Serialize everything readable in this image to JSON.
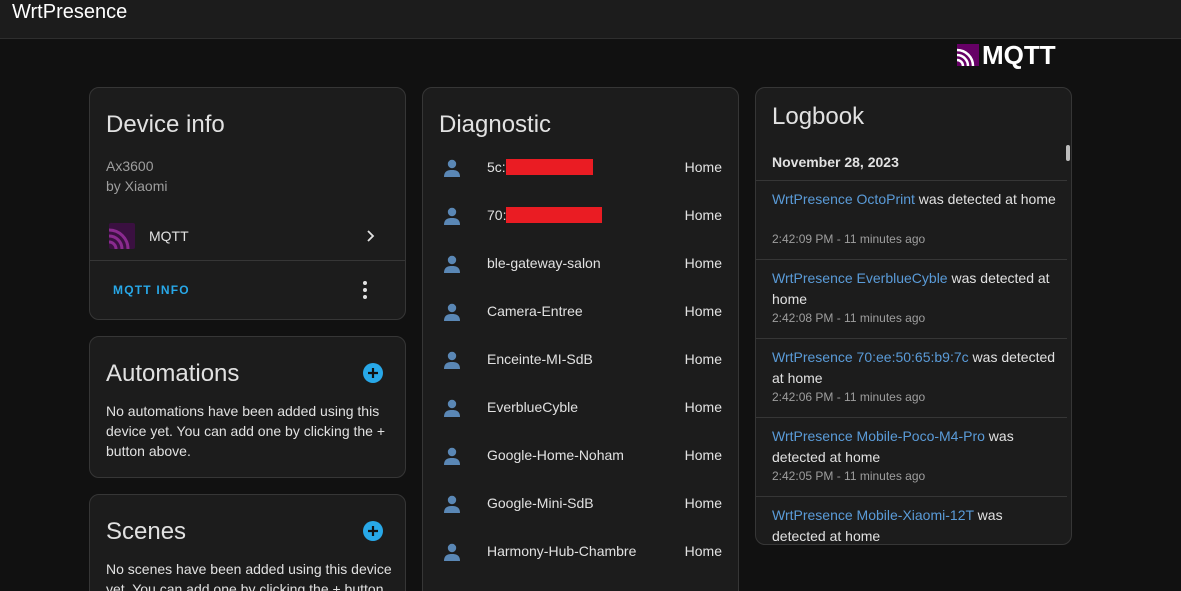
{
  "app": {
    "title": "WrtPresence"
  },
  "integration_logo": {
    "text": "MQTT"
  },
  "colors": {
    "accent": "#28a8e8",
    "link": "#5a9bd8",
    "person_icon": "#5a87b5",
    "redaction": "#ea1c23",
    "mqtt_logo": "#660066"
  },
  "device_info": {
    "title": "Device info",
    "model": "Ax3600",
    "manufacturer": "by Xiaomi",
    "integration_label": "MQTT",
    "action_button": "MQTT INFO"
  },
  "automations": {
    "title": "Automations",
    "empty_text": "No automations have been added using this device yet. You can add one by clicking the + button above."
  },
  "scenes": {
    "title": "Scenes",
    "empty_text": "No scenes have been added using this device yet. You can add one by clicking the + button above."
  },
  "diagnostic": {
    "title": "Diagnostic",
    "entities": [
      {
        "icon": "person-icon",
        "name": "5c:",
        "redacted": true,
        "state": "Home"
      },
      {
        "icon": "person-icon",
        "name": "70:",
        "redacted": true,
        "state": "Home"
      },
      {
        "icon": "person-icon",
        "name": "ble-gateway-salon",
        "redacted": false,
        "state": "Home"
      },
      {
        "icon": "person-icon",
        "name": "Camera-Entree",
        "redacted": false,
        "state": "Home"
      },
      {
        "icon": "person-icon",
        "name": "Enceinte-MI-SdB",
        "redacted": false,
        "state": "Home"
      },
      {
        "icon": "person-icon",
        "name": "EverblueCyble",
        "redacted": false,
        "state": "Home"
      },
      {
        "icon": "person-icon",
        "name": "Google-Home-Noham",
        "redacted": false,
        "state": "Home"
      },
      {
        "icon": "person-icon",
        "name": "Google-Mini-SdB",
        "redacted": false,
        "state": "Home"
      },
      {
        "icon": "person-icon",
        "name": "Harmony-Hub-Chambre",
        "redacted": false,
        "state": "Home"
      }
    ]
  },
  "logbook": {
    "title": "Logbook",
    "date": "November 28, 2023",
    "entries": [
      {
        "entity": "WrtPresence OctoPrint",
        "message": " was detected at home",
        "time": "2:42:09 PM - 11 minutes ago"
      },
      {
        "entity": "WrtPresence EverblueCyble",
        "message": " was detected at home",
        "time": "2:42:08 PM - 11 minutes ago"
      },
      {
        "entity": "WrtPresence 70:ee:50:65:b9:7c",
        "message": " was detected at home",
        "time": "2:42:06 PM - 11 minutes ago"
      },
      {
        "entity": "WrtPresence Mobile-Poco-M4-Pro",
        "message": " was detected at home",
        "time": "2:42:05 PM - 11 minutes ago"
      },
      {
        "entity": "WrtPresence Mobile-Xiaomi-12T",
        "message": " was detected at home",
        "time": ""
      }
    ]
  }
}
